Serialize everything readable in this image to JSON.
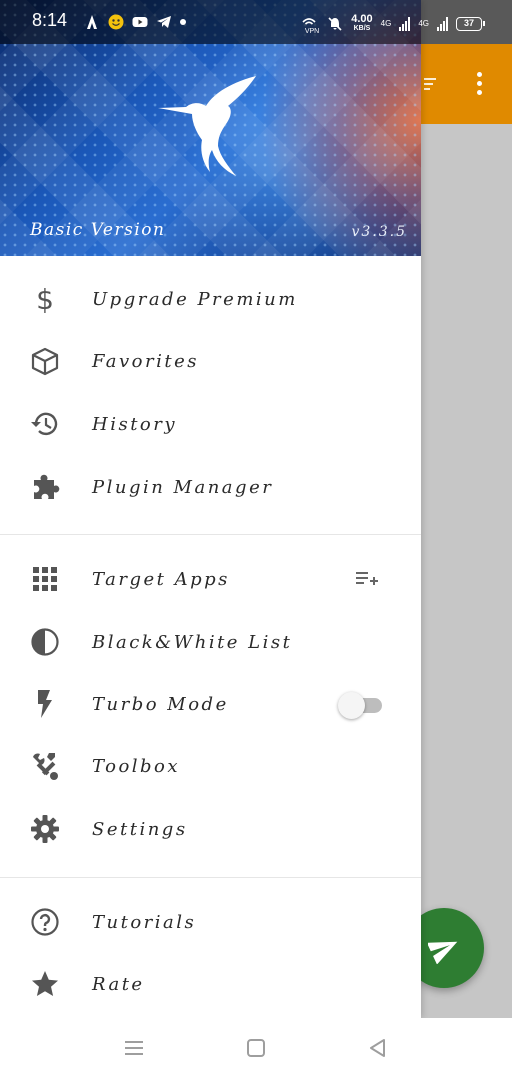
{
  "status_bar": {
    "time": "8:14",
    "net_speed_value": "4.00",
    "net_speed_unit": "KB/S",
    "vpn_label": "VPN",
    "sim1_label": "4G",
    "sim2_label": "4G",
    "battery_level": "37",
    "left_icons": [
      "signal-boost-icon",
      "smiley-icon",
      "youtube-icon",
      "telegram-icon",
      "notification-dot-icon"
    ],
    "right_icons": [
      "vpn-icon",
      "mute-icon",
      "signal-icon",
      "signal-icon",
      "battery-icon"
    ]
  },
  "drawer": {
    "header": {
      "left_text": "Basic Version",
      "right_text": "v3.3.5",
      "logo_icon": "hummingbird-icon"
    },
    "items": [
      {
        "label": "Upgrade Premium",
        "icon": "dollar-icon"
      },
      {
        "label": "Favorites",
        "icon": "box-icon"
      },
      {
        "label": "History",
        "icon": "history-icon"
      },
      {
        "label": "Plugin Manager",
        "icon": "puzzle-icon"
      },
      {
        "label": "Target Apps",
        "icon": "grid-icon",
        "trailing": "playlist-add-icon"
      },
      {
        "label": "Black&White List",
        "icon": "contrast-icon"
      },
      {
        "label": "Turbo Mode",
        "icon": "flash-icon",
        "trailing": "toggle",
        "toggle_on": false
      },
      {
        "label": "Toolbox",
        "icon": "tools-icon"
      },
      {
        "label": "Settings",
        "icon": "gear-icon"
      },
      {
        "label": "Tutorials",
        "icon": "help-icon"
      },
      {
        "label": "Rate",
        "icon": "star-icon"
      }
    ]
  },
  "background_app": {
    "toolbar_color": "#e08a00",
    "fab_color": "#2e7d32",
    "fab_icon": "send-icon"
  },
  "navigation_bar": {
    "buttons": [
      "menu-icon",
      "home-icon",
      "back-icon"
    ]
  }
}
